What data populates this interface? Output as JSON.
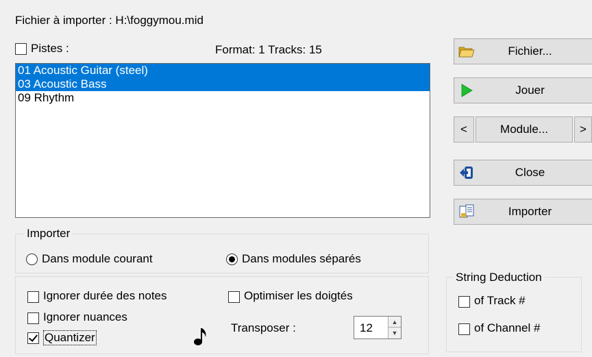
{
  "header": {
    "file_label": "Fichier à importer : H:\\foggymou.mid"
  },
  "tracks": {
    "pistes_label": "Pistes :",
    "pistes_checked": false,
    "format_info": "Format: 1 Tracks: 15",
    "items": [
      {
        "label": "01 Acoustic Guitar (steel)",
        "selected": true
      },
      {
        "label": "03 Acoustic Bass",
        "selected": true
      },
      {
        "label": "09 Rhythm",
        "selected": false
      }
    ]
  },
  "buttons": {
    "fichier": "Fichier...",
    "jouer": "Jouer",
    "module": "Module...",
    "prev": "<",
    "next": ">",
    "close": "Close",
    "importer": "Importer"
  },
  "importer_group": {
    "legend": "Importer",
    "option_current": "Dans module courant",
    "option_separate": "Dans modules séparés",
    "selected": "separate"
  },
  "options": {
    "ignorer_duree": {
      "label": "Ignorer durée des notes",
      "checked": false
    },
    "ignorer_nuances": {
      "label": "Ignorer nuances",
      "checked": false
    },
    "quantizer": {
      "label": "Quantizer",
      "checked": true
    },
    "optimiser": {
      "label": "Optimiser les doigtés",
      "checked": false
    },
    "transposer_label": "Transposer :",
    "transposer_value": "12"
  },
  "string_deduction": {
    "legend": "String Deduction",
    "track": {
      "label": "of Track #",
      "checked": false
    },
    "channel": {
      "label": "of Channel #",
      "checked": false
    }
  },
  "icons": {
    "fichier": "folder-open-icon",
    "jouer": "play-icon",
    "close": "exit-arrow-icon",
    "importer": "import-document-icon",
    "note": "music-note-icon"
  },
  "colors": {
    "selection": "#0078d7",
    "play_green": "#1fbf2f"
  }
}
